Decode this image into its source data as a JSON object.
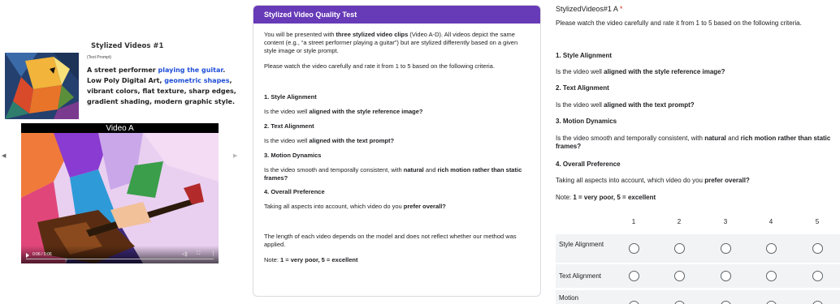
{
  "left": {
    "title": "Stylized Videos #1",
    "label": "(Text Prompt)",
    "prompt": {
      "p1": "A street performer ",
      "h1": "playing the guitar",
      "p2": ". Low Poly Digital Art, ",
      "h2": "geometric shapes",
      "p3": ", vibrant colors, flat texture, sharp edges, gradient shading, modern graphic style."
    },
    "video": {
      "label": "Video A",
      "time": "0:06 / 0:06",
      "progress": 1.0
    }
  },
  "middle": {
    "header": "Stylized Video Quality Test",
    "intro": {
      "p1": "You will be presented with ",
      "b1": "three stylized video clips",
      "p2": " (Video A-D). All videos depict the same content (e.g., “a street performer playing a guitar”) but are stylized differently based on a given style image or style prompt."
    },
    "instruction": "Please watch the video carefully and rate it from 1 to 5 based on the following criteria.",
    "criteria": [
      {
        "title": "1. Style Alignment",
        "pre": "Is the video well ",
        "bold": "aligned with the style reference image?",
        "mid": "",
        "bold2": "",
        "post": ""
      },
      {
        "title": "2. Text Alignment",
        "pre": "Is the video well ",
        "bold": "aligned with the text prompt?",
        "mid": "",
        "bold2": "",
        "post": ""
      },
      {
        "title": "3. Motion Dynamics",
        "pre": "Is the video smooth and temporally consistent, with ",
        "bold": "natural",
        "mid": " and ",
        "bold2": "rich motion rather than static  frames?",
        "post": ""
      },
      {
        "title": "4. Overall Preference",
        "pre": "Taking all aspects into account, which video do you ",
        "bold": "prefer overall?",
        "mid": "",
        "bold2": "",
        "post": ""
      }
    ],
    "length_note": "The length of each video depends on the model and does not reflect whether our method was applied.",
    "note_pre": "Note: ",
    "note_bold": "1 = very poor, 5 = excellent"
  },
  "right": {
    "title": "StylizedVideos#1 A",
    "required": "*",
    "instruction": "Please watch the video carefully and rate it from 1 to 5 based on the following criteria.",
    "criteria": [
      {
        "title": "1. Style Alignment",
        "pre": "Is the video well ",
        "bold": "aligned with the style reference image?",
        "mid": "",
        "bold2": ""
      },
      {
        "title": "2. Text Alignment",
        "pre": "Is the video well ",
        "bold": "aligned with the text prompt?",
        "mid": "",
        "bold2": ""
      },
      {
        "title": "3. Motion Dynamics",
        "pre": "Is the video smooth and temporally consistent, with ",
        "bold": "natural",
        "mid": " and ",
        "bold2": "rich motion rather than static  frames?"
      },
      {
        "title": "4. Overall Preference",
        "pre": "Taking all aspects into account, which video do you ",
        "bold": "prefer overall?",
        "mid": "",
        "bold2": ""
      }
    ],
    "note_pre": "Note: ",
    "note_bold": "1 = very poor, 5 = excellent",
    "scale": [
      "1",
      "2",
      "3",
      "4",
      "5"
    ],
    "rows": [
      {
        "label": "Style Alignment"
      },
      {
        "label": "Text Alignment"
      },
      {
        "label": "Motion"
      }
    ]
  },
  "colors": {
    "accent": "#673ab7",
    "required": "#d93025",
    "highlight": "#1f4ed8",
    "row_bg": "#f1f3f4"
  }
}
